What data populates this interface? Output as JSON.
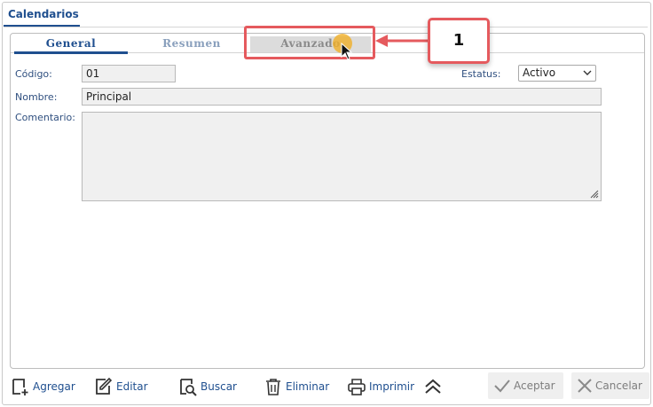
{
  "window": {
    "tab_label": "Calendarios"
  },
  "tabs": [
    {
      "label": "General",
      "active": true
    },
    {
      "label": "Resumen",
      "active": false
    },
    {
      "label": "Avanzado",
      "active": false
    }
  ],
  "form": {
    "codigo": {
      "label": "Código:",
      "value": "01"
    },
    "estatus": {
      "label": "Estatus:",
      "value": "Activo"
    },
    "nombre": {
      "label": "Nombre:",
      "value": "Principal"
    },
    "comentario": {
      "label": "Comentario:",
      "value": ""
    }
  },
  "annotation": {
    "number": "1",
    "color": "#e55a5e"
  },
  "toolbar": {
    "agregar": "Agregar",
    "editar": "Editar",
    "buscar": "Buscar",
    "eliminar": "Eliminar",
    "imprimir": "Imprimir",
    "aceptar": "Aceptar",
    "cancelar": "Cancelar"
  },
  "colors": {
    "accent": "#1f4f8f",
    "annotation": "#e55a5e"
  }
}
